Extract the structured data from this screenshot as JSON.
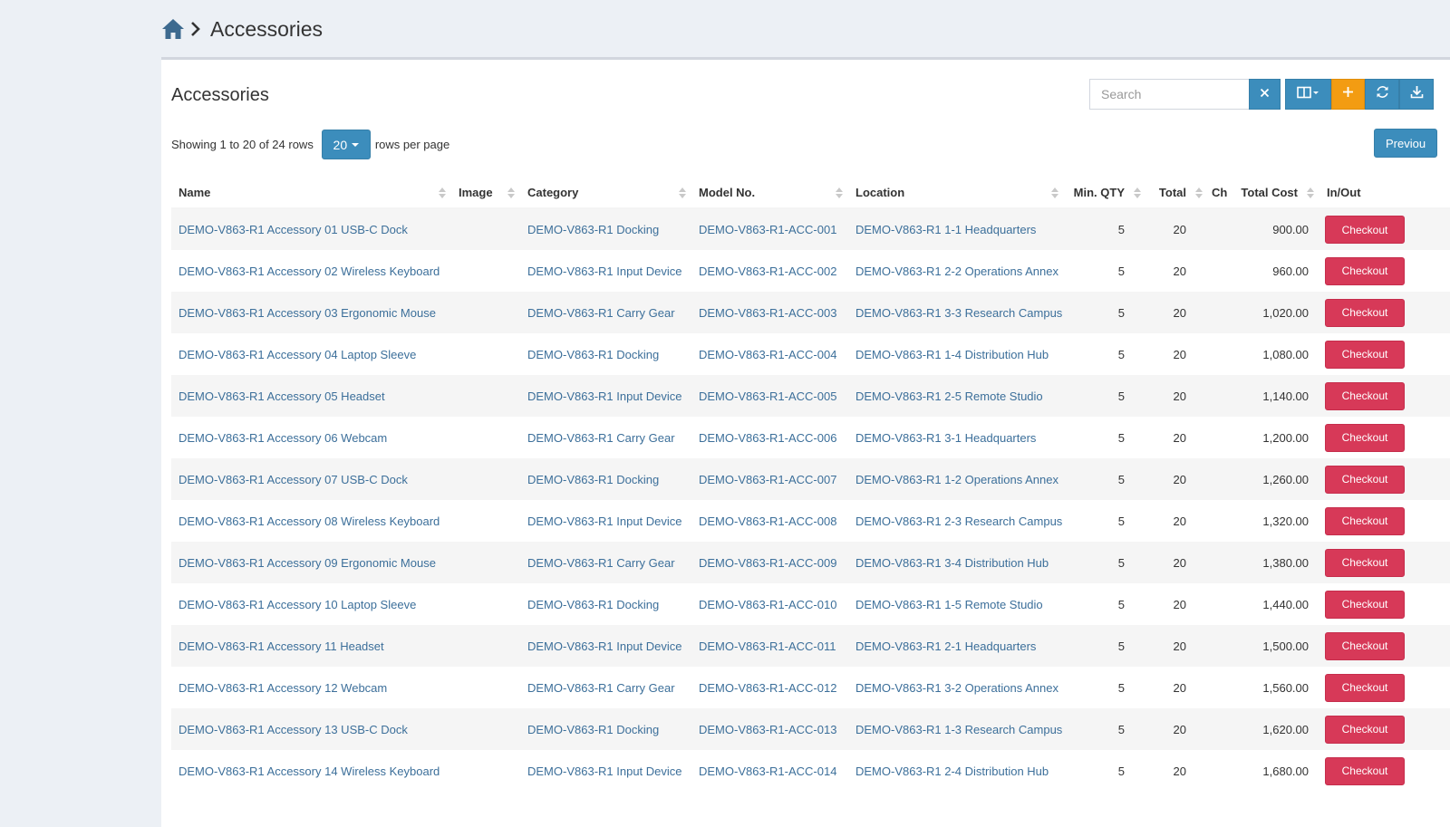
{
  "breadcrumb": {
    "current": "Accessories"
  },
  "box": {
    "title": "Accessories",
    "search_placeholder": "Search",
    "previous_label": "Previou"
  },
  "pagination": {
    "showing_text": "Showing 1 to 20 of 24 rows",
    "page_size": "20",
    "rows_per_page_text": "rows per page"
  },
  "columns": {
    "name": "Name",
    "image": "Image",
    "category": "Category",
    "model": "Model No.",
    "location": "Location",
    "min_qty": "Min. QTY",
    "total": "Total",
    "checked_out": "Ch",
    "total_cost": "Total Cost",
    "inout": "In/Out"
  },
  "checkout_label": "Checkout",
  "rows": [
    {
      "name": "DEMO-V863-R1 Accessory 01 USB-C Dock",
      "category": "DEMO-V863-R1 Docking",
      "model": "DEMO-V863-R1-ACC-001",
      "location": "DEMO-V863-R1 1-1 Headquarters",
      "min_qty": "5",
      "total": "20",
      "total_cost": "900.00"
    },
    {
      "name": "DEMO-V863-R1 Accessory 02 Wireless Keyboard",
      "category": "DEMO-V863-R1 Input Device",
      "model": "DEMO-V863-R1-ACC-002",
      "location": "DEMO-V863-R1 2-2 Operations Annex",
      "min_qty": "5",
      "total": "20",
      "total_cost": "960.00"
    },
    {
      "name": "DEMO-V863-R1 Accessory 03 Ergonomic Mouse",
      "category": "DEMO-V863-R1 Carry Gear",
      "model": "DEMO-V863-R1-ACC-003",
      "location": "DEMO-V863-R1 3-3 Research Campus",
      "min_qty": "5",
      "total": "20",
      "total_cost": "1,020.00"
    },
    {
      "name": "DEMO-V863-R1 Accessory 04 Laptop Sleeve",
      "category": "DEMO-V863-R1 Docking",
      "model": "DEMO-V863-R1-ACC-004",
      "location": "DEMO-V863-R1 1-4 Distribution Hub",
      "min_qty": "5",
      "total": "20",
      "total_cost": "1,080.00"
    },
    {
      "name": "DEMO-V863-R1 Accessory 05 Headset",
      "category": "DEMO-V863-R1 Input Device",
      "model": "DEMO-V863-R1-ACC-005",
      "location": "DEMO-V863-R1 2-5 Remote Studio",
      "min_qty": "5",
      "total": "20",
      "total_cost": "1,140.00"
    },
    {
      "name": "DEMO-V863-R1 Accessory 06 Webcam",
      "category": "DEMO-V863-R1 Carry Gear",
      "model": "DEMO-V863-R1-ACC-006",
      "location": "DEMO-V863-R1 3-1 Headquarters",
      "min_qty": "5",
      "total": "20",
      "total_cost": "1,200.00"
    },
    {
      "name": "DEMO-V863-R1 Accessory 07 USB-C Dock",
      "category": "DEMO-V863-R1 Docking",
      "model": "DEMO-V863-R1-ACC-007",
      "location": "DEMO-V863-R1 1-2 Operations Annex",
      "min_qty": "5",
      "total": "20",
      "total_cost": "1,260.00"
    },
    {
      "name": "DEMO-V863-R1 Accessory 08 Wireless Keyboard",
      "category": "DEMO-V863-R1 Input Device",
      "model": "DEMO-V863-R1-ACC-008",
      "location": "DEMO-V863-R1 2-3 Research Campus",
      "min_qty": "5",
      "total": "20",
      "total_cost": "1,320.00"
    },
    {
      "name": "DEMO-V863-R1 Accessory 09 Ergonomic Mouse",
      "category": "DEMO-V863-R1 Carry Gear",
      "model": "DEMO-V863-R1-ACC-009",
      "location": "DEMO-V863-R1 3-4 Distribution Hub",
      "min_qty": "5",
      "total": "20",
      "total_cost": "1,380.00"
    },
    {
      "name": "DEMO-V863-R1 Accessory 10 Laptop Sleeve",
      "category": "DEMO-V863-R1 Docking",
      "model": "DEMO-V863-R1-ACC-010",
      "location": "DEMO-V863-R1 1-5 Remote Studio",
      "min_qty": "5",
      "total": "20",
      "total_cost": "1,440.00"
    },
    {
      "name": "DEMO-V863-R1 Accessory 11 Headset",
      "category": "DEMO-V863-R1 Input Device",
      "model": "DEMO-V863-R1-ACC-011",
      "location": "DEMO-V863-R1 2-1 Headquarters",
      "min_qty": "5",
      "total": "20",
      "total_cost": "1,500.00"
    },
    {
      "name": "DEMO-V863-R1 Accessory 12 Webcam",
      "category": "DEMO-V863-R1 Carry Gear",
      "model": "DEMO-V863-R1-ACC-012",
      "location": "DEMO-V863-R1 3-2 Operations Annex",
      "min_qty": "5",
      "total": "20",
      "total_cost": "1,560.00"
    },
    {
      "name": "DEMO-V863-R1 Accessory 13 USB-C Dock",
      "category": "DEMO-V863-R1 Docking",
      "model": "DEMO-V863-R1-ACC-013",
      "location": "DEMO-V863-R1 1-3 Research Campus",
      "min_qty": "5",
      "total": "20",
      "total_cost": "1,620.00"
    },
    {
      "name": "DEMO-V863-R1 Accessory 14 Wireless Keyboard",
      "category": "DEMO-V863-R1 Input Device",
      "model": "DEMO-V863-R1-ACC-014",
      "location": "DEMO-V863-R1 2-4 Distribution Hub",
      "min_qty": "5",
      "total": "20",
      "total_cost": "1,680.00"
    }
  ],
  "colors": {
    "primary": "#3c8dbc",
    "warning": "#f39c12",
    "danger": "#d73958",
    "link": "#3c6f9a",
    "background": "#ecf0f5"
  },
  "icons": {
    "home": "home-icon",
    "breadcrumb_separator": "chevron-right-icon",
    "clear": "close-icon",
    "columns": "columns-icon",
    "add": "plus-icon",
    "refresh": "refresh-icon",
    "export": "download-icon"
  }
}
